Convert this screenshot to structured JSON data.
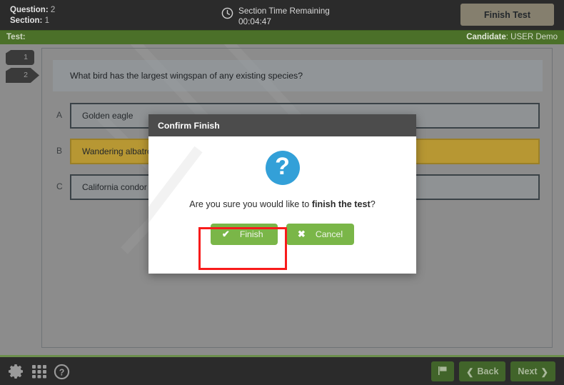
{
  "header": {
    "question_label": "Question:",
    "question_value": "2",
    "section_label": "Section:",
    "section_value": "1",
    "timer_title": "Section Time Remaining",
    "timer_value": "00:04:47",
    "finish_test_button": "Finish Test",
    "clock_icon": "clock-icon"
  },
  "infobar": {
    "test_label": "Test:",
    "candidate_label": "Candidate",
    "candidate_sep": ": ",
    "candidate_name": "USER Demo",
    "bar_color": "#4b7029"
  },
  "question_nav": {
    "tabs": [
      {
        "label": "1",
        "current": false
      },
      {
        "label": "2",
        "current": true
      }
    ]
  },
  "question": {
    "text": "What bird has the largest wingspan of any existing species?",
    "options": [
      {
        "letter": "A",
        "text": "Golden eagle",
        "selected": false
      },
      {
        "letter": "B",
        "text": "Wandering albatross",
        "selected": true
      },
      {
        "letter": "C",
        "text": "California condor",
        "selected": false
      }
    ],
    "selected_color": "#b79733"
  },
  "dialog": {
    "title": "Confirm Finish",
    "icon": "question-mark-icon",
    "icon_color": "#33a0d8",
    "message_prefix": "Are you sure you would like to ",
    "message_bold": "finish the test",
    "message_suffix": "?",
    "finish_button": "Finish",
    "finish_icon": "check-icon",
    "cancel_button": "Cancel",
    "cancel_icon": "cross-icon",
    "button_color": "#7ab648",
    "highlight_color": "#f81b1b"
  },
  "bottombar": {
    "settings_icon": "gear-icon",
    "grid_icon": "grid-icon",
    "help_icon": "help-circle-icon",
    "flag_icon": "flag-icon",
    "back_button": "Back",
    "next_button": "Next",
    "back_icon": "chevron-left-icon",
    "next_icon": "chevron-right-icon"
  }
}
